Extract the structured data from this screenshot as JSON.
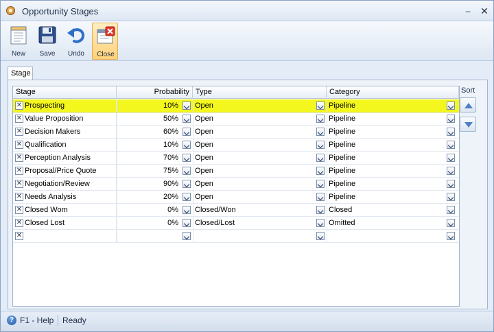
{
  "window": {
    "title": "Opportunity Stages"
  },
  "toolbar": {
    "buttons": [
      {
        "label": "New",
        "icon": "new-document-icon"
      },
      {
        "label": "Save",
        "icon": "floppy-disk-icon"
      },
      {
        "label": "Undo",
        "icon": "undo-arrow-icon"
      },
      {
        "label": "Close",
        "icon": "close-window-icon",
        "active": true
      }
    ]
  },
  "tab": {
    "label": "Stage"
  },
  "grid": {
    "columns": {
      "stage": "Stage",
      "probability": "Probability",
      "type": "Type",
      "category": "Category"
    },
    "rows": [
      {
        "stage": "Prospecting",
        "probability": "10%",
        "type": "Open",
        "category": "Pipeline",
        "selected": true
      },
      {
        "stage": "Value Proposition",
        "probability": "50%",
        "type": "Open",
        "category": "Pipeline"
      },
      {
        "stage": "Decision Makers",
        "probability": "60%",
        "type": "Open",
        "category": "Pipeline"
      },
      {
        "stage": "Qualification",
        "probability": "10%",
        "type": "Open",
        "category": "Pipeline"
      },
      {
        "stage": "Perception Analysis",
        "probability": "70%",
        "type": "Open",
        "category": "Pipeline"
      },
      {
        "stage": "Proposal/Price Quote",
        "probability": "75%",
        "type": "Open",
        "category": "Pipeline"
      },
      {
        "stage": "Negotiation/Review",
        "probability": "90%",
        "type": "Open",
        "category": "Pipeline"
      },
      {
        "stage": "Needs Analysis",
        "probability": "20%",
        "type": "Open",
        "category": "Pipeline"
      },
      {
        "stage": "Closed Wom",
        "probability": "0%",
        "type": "Closed/Won",
        "category": "Closed"
      },
      {
        "stage": "Closed Lost",
        "probability": "0%",
        "type": "Closed/Lost",
        "category": "Omitted"
      },
      {
        "stage": "",
        "probability": "",
        "type": "",
        "category": ""
      }
    ],
    "delete_glyph": "✕",
    "highlight_color": "#f4f71d"
  },
  "sort": {
    "label": "Sort"
  },
  "status": {
    "help": "F1 - Help",
    "text": "Ready"
  }
}
